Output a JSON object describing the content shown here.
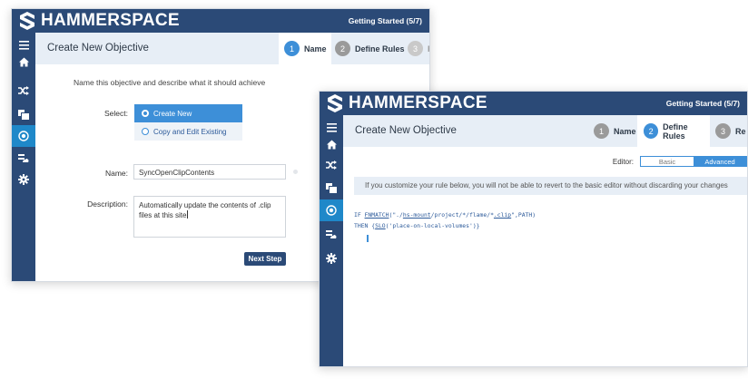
{
  "brand": {
    "name": "HAMMERSPACE"
  },
  "colors": {
    "navy": "#2b4a77",
    "accent": "#3d8fd8",
    "active_nav": "#1f88c9",
    "header_bg": "#e7eef6"
  },
  "sidebar_icons": [
    "menu-icon",
    "home-icon",
    "shuffle-icon",
    "files-icon",
    "target-icon",
    "cloud-stack-icon",
    "gear-icon"
  ],
  "screen1": {
    "getting_started": "Getting Started (5/7)",
    "page_title": "Create New Objective",
    "steps": [
      {
        "num": "1",
        "label": "Name"
      },
      {
        "num": "2",
        "label": "Define Rules"
      },
      {
        "num": "3",
        "label": "Re"
      }
    ],
    "intro": "Name this objective and describe what it should achieve",
    "select_label": "Select:",
    "options": [
      {
        "label": "Create New",
        "selected": true
      },
      {
        "label": "Copy and Edit Existing",
        "selected": false
      }
    ],
    "name_label": "Name:",
    "name_value": "SyncOpenClipContents",
    "description_label": "Description:",
    "description_value": "Automatically update the contents of .clip files at this site",
    "next_button": "Next Step"
  },
  "screen2": {
    "getting_started": "Getting Started (5/7)",
    "page_title": "Create New Objective",
    "steps": [
      {
        "num": "1",
        "label": "Name"
      },
      {
        "num": "2",
        "label": "Define Rules"
      },
      {
        "num": "3",
        "label": "Re"
      }
    ],
    "editor_label": "Editor:",
    "editor_options": [
      "Basic",
      "Advanced"
    ],
    "editor_selected": "Advanced",
    "warning": "If you customize your rule below, you will not be able to revert to the basic editor without discarding your changes",
    "code": {
      "line1_a": "IF ",
      "line1_fn": "FNMATCH",
      "line1_b": "(\"./",
      "line1_mount": "hs-mount",
      "line1_c": "/project/*/flame/*",
      "line1_ext": ".clip",
      "line1_d": "\",PATH)",
      "line2_a": "THEN {",
      "line2_slo": "SLO",
      "line2_b": "('place-on-local-volumes')}"
    }
  }
}
